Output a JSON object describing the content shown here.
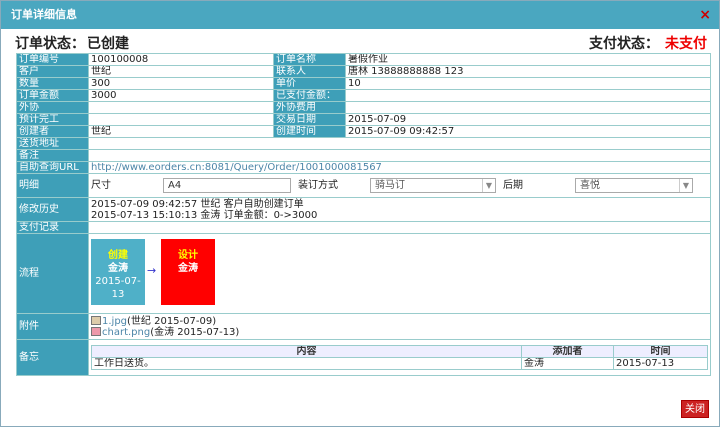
{
  "window": {
    "title": "订单详细信息",
    "close_glyph": "×"
  },
  "status": {
    "order_label": "订单状态：",
    "order_value": "已创建",
    "pay_label": "支付状态：",
    "pay_value": "未支付"
  },
  "fields": {
    "order_no_label": "订单编号",
    "order_no": "100100008",
    "order_name_label": "订单名称",
    "order_name": "暑假作业",
    "customer_label": "客户",
    "customer": "世纪",
    "contact_label": "联系人",
    "contact": "唐林 13888888888 123",
    "quantity_label": "数量",
    "quantity": "300",
    "unit_price_label": "单价",
    "unit_price": "10",
    "amount_label": "订单金额",
    "amount": "3000",
    "paid_label": "已支付金额：",
    "paid": "",
    "outsource_label": "外协",
    "outsource": "",
    "outsource_fee_label": "外协费用",
    "outsource_fee": "",
    "expected_label": "预计完工",
    "expected": "",
    "trade_date_label": "交易日期",
    "trade_date": "2015-07-09",
    "creator_label": "创建者",
    "creator": "世纪",
    "created_time_label": "创建时间",
    "created_time": "2015-07-09 09:42:57",
    "address_label": "送货地址",
    "address": "",
    "remark_label": "备注",
    "remark": "",
    "url_label": "自助查询URL",
    "url": "http://www.eorders.cn:8081/Query/Order/1001000081567"
  },
  "detail": {
    "label": "明细",
    "size_label": "尺寸",
    "size_value": "A4",
    "binding_label": "装订方式",
    "binding_value": "骑马订",
    "post_label": "后期",
    "post_value": "喜悦"
  },
  "history": {
    "label": "修改历史",
    "lines": [
      "2015-07-09 09:42:57 世纪 客户自助创建订单",
      "2015-07-13 15:10:13 金涛 订单金额：0->3000"
    ]
  },
  "payments": {
    "label": "支付记录"
  },
  "flow": {
    "label": "流程",
    "arrow": "→",
    "nodes": [
      {
        "title": "创建",
        "person": "金涛",
        "date": "2015-07-13"
      },
      {
        "title": "设计",
        "person": "金涛"
      }
    ]
  },
  "attachments": {
    "label": "附件",
    "files": [
      {
        "name": "1.jpg",
        "meta": "(世纪 2015-07-09)"
      },
      {
        "name": "chart.png",
        "meta": "(金涛 2015-07-13)"
      }
    ]
  },
  "memo": {
    "label": "备忘",
    "headers": [
      "内容",
      "添加者",
      "时间"
    ],
    "rows": [
      {
        "content": "工作日送货。",
        "author": "金涛",
        "time": "2015-07-13"
      }
    ]
  },
  "footer": {
    "close_label": "关闭"
  },
  "colors": {
    "titlebar": "#4aa7c0",
    "label_bg": "#3e9fb8",
    "pay_status": "#ee0000",
    "node_create": "#4fb0c8",
    "node_design": "#ff0000"
  }
}
